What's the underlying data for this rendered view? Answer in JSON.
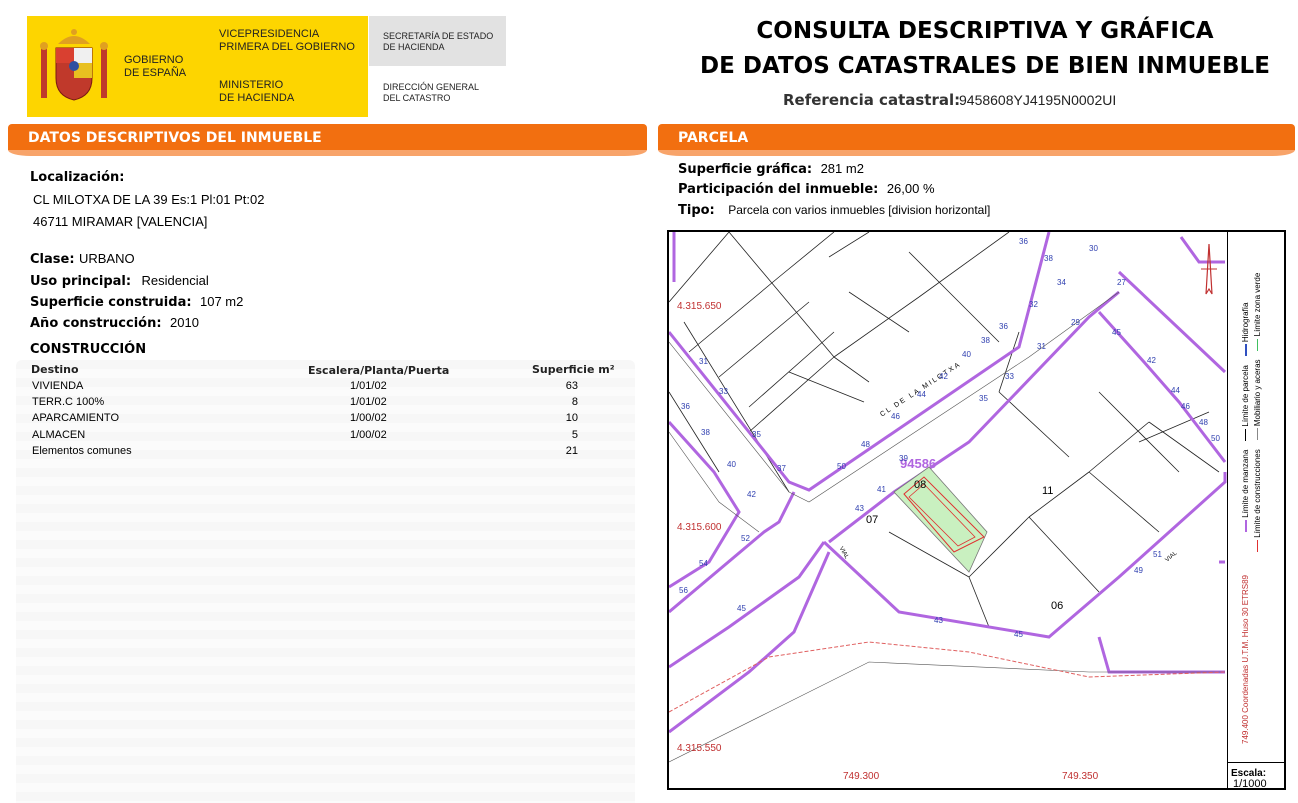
{
  "header": {
    "gobierno": [
      "GOBIERNO",
      "DE ESPAÑA"
    ],
    "vicepresidencia": [
      "VICEPRESIDENCIA",
      "PRIMERA DEL GOBIERNO"
    ],
    "ministerio": [
      "MINISTERIO",
      "DE HACIENDA"
    ],
    "secretaria": [
      "SECRETARÍA DE ESTADO",
      "DE HACIENDA"
    ],
    "direccion": [
      "DIRECCIÓN GENERAL",
      "DEL CATASTRO"
    ],
    "title_line1": "CONSULTA DESCRIPTIVA Y GRÁFICA",
    "title_line2": "DE DATOS CATASTRALES DE BIEN INMUEBLE",
    "ref_label": "Referencia catastral:",
    "ref_value": "9458608YJ4195N0002UI"
  },
  "descriptivos": {
    "section_title": "DATOS DESCRIPTIVOS DEL INMUEBLE",
    "localizacion_label": "Localización:",
    "localizacion_line1": "CL MILOTXA DE LA 39 Es:1 Pl:01 Pt:02",
    "localizacion_line2": "46711 MIRAMAR [VALENCIA]",
    "clase_label": "Clase:",
    "clase_value": "URBANO",
    "uso_label": "Uso principal:",
    "uso_value": "Residencial",
    "superficie_label": "Superficie construida:",
    "superficie_value": "107 m2",
    "anio_label": "Año construcción:",
    "anio_value": "2010"
  },
  "construccion": {
    "title": "CONSTRUCCIÓN",
    "col_destino": "Destino",
    "col_escalera": "Escalera/Planta/Puerta",
    "col_superficie": "Superficie m²",
    "rows": [
      {
        "destino": "VIVIENDA",
        "escalera": "1/01/02",
        "superficie": "63"
      },
      {
        "destino": "TERR.C 100%",
        "escalera": "1/01/02",
        "superficie": "8"
      },
      {
        "destino": "APARCAMIENTO",
        "escalera": "1/00/02",
        "superficie": "10"
      },
      {
        "destino": "ALMACEN",
        "escalera": "1/00/02",
        "superficie": "5"
      },
      {
        "destino": "Elementos comunes",
        "escalera": "",
        "superficie": "21"
      }
    ]
  },
  "parcela": {
    "section_title": "PARCELA",
    "sup_label": "Superficie gráfica:",
    "sup_value": "281 m2",
    "part_label": "Participación del inmueble:",
    "part_value": "26,00 %",
    "tipo_label": "Tipo:",
    "tipo_value": "Parcela con varios inmuebles [division horizontal]"
  },
  "map": {
    "y_labels": [
      "4.315.650",
      "4.315.600",
      "4.315.550"
    ],
    "x_labels": [
      "749.300",
      "749.350"
    ],
    "street": "CL DE LA MILOTXA",
    "block": "94586",
    "parcels": [
      "08",
      "07",
      "11",
      "06"
    ],
    "vial": "VIAL",
    "street_numbers": [
      "36",
      "38",
      "30",
      "34",
      "32",
      "36",
      "38",
      "40",
      "42",
      "44",
      "46",
      "48",
      "50",
      "31",
      "33",
      "35",
      "37",
      "39",
      "41",
      "43",
      "27",
      "29",
      "31",
      "33",
      "35",
      "45",
      "42",
      "44",
      "46",
      "48",
      "50",
      "51",
      "49",
      "43",
      "45",
      "45",
      "52",
      "54",
      "56",
      "51",
      "40",
      "42",
      "36",
      "38",
      "62"
    ],
    "legend": {
      "manzana": "Límite de manzana",
      "parcela": "Límite de parcela",
      "hidrografia": "Hidrografía",
      "construcciones": "Límite de construcciones",
      "mobiliario": "Mobiliario y aceras",
      "zona_verde": "Límite zona verde",
      "coordenadas": "749.400 Coordenadas U.T.M. Huso 30 ETRS89"
    },
    "escala_label": "Escala:",
    "escala_value": "1/1000"
  },
  "colors": {
    "orange": "#f26f10",
    "yellow": "#fdd500",
    "purple": "#b066e0",
    "green": "#c9f0c0"
  }
}
